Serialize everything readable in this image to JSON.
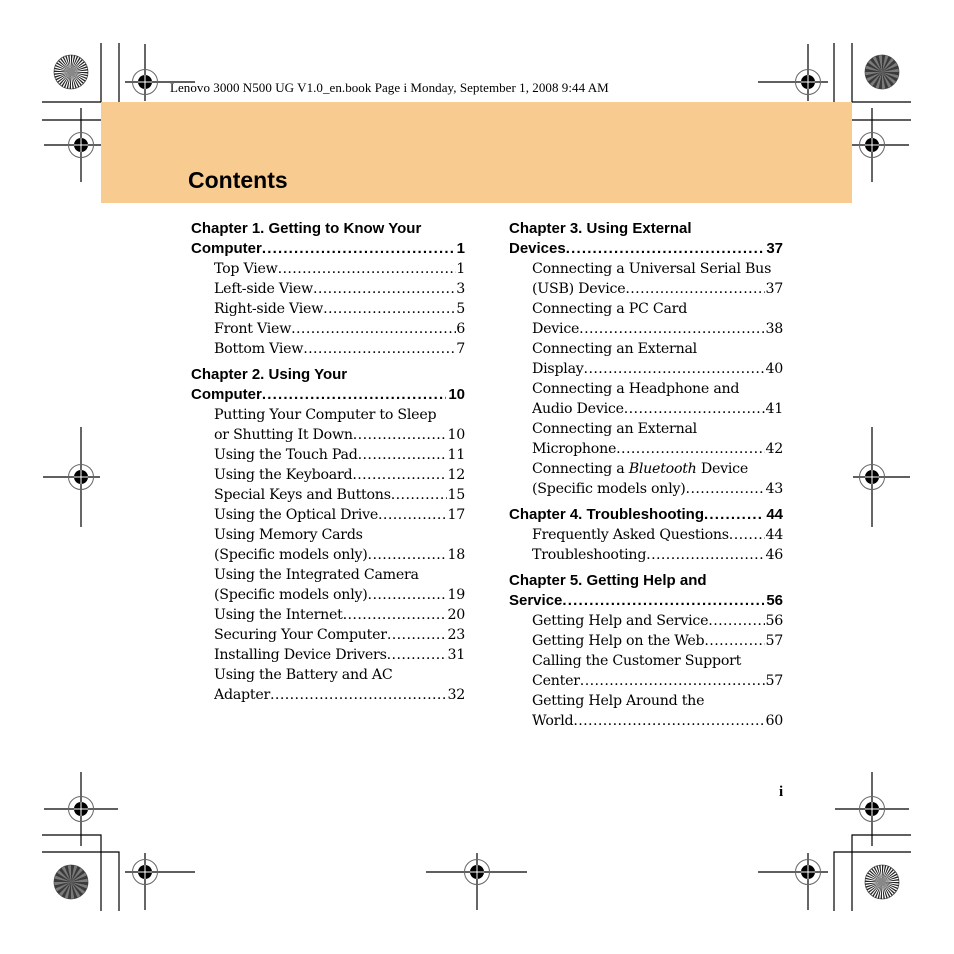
{
  "header": {
    "running_line": "Lenovo 3000 N500 UG V1.0_en.book  Page i  Monday, September 1, 2008  9:44 AM"
  },
  "band": {
    "title": "Contents",
    "color": "#f8cc90"
  },
  "left_column": [
    {
      "chapter_line1": "Chapter 1. Getting to Know Your",
      "chapter_line2": "Computer",
      "page": "1",
      "entries": [
        {
          "lines": [
            "Top View"
          ],
          "page": "1"
        },
        {
          "lines": [
            "Left-side View"
          ],
          "page": "3"
        },
        {
          "lines": [
            "Right-side View"
          ],
          "page": "5"
        },
        {
          "lines": [
            "Front View"
          ],
          "page": "6"
        },
        {
          "lines": [
            "Bottom View"
          ],
          "page": "7"
        }
      ]
    },
    {
      "chapter_line1": "Chapter 2. Using Your",
      "chapter_line2": "Computer",
      "page": "10",
      "entries": [
        {
          "lines": [
            "Putting Your Computer to Sleep",
            "or Shutting It Down"
          ],
          "page": "10"
        },
        {
          "lines": [
            "Using the Touch Pad"
          ],
          "page": "11"
        },
        {
          "lines": [
            "Using the Keyboard"
          ],
          "page": "12"
        },
        {
          "lines": [
            "Special Keys and Buttons"
          ],
          "page": "15"
        },
        {
          "lines": [
            "Using the Optical Drive"
          ],
          "page": "17"
        },
        {
          "lines": [
            "Using Memory Cards",
            "(Specific models only)"
          ],
          "page": "18"
        },
        {
          "lines": [
            "Using the Integrated Camera",
            "(Specific models only)"
          ],
          "page": "19"
        },
        {
          "lines": [
            "Using the Internet"
          ],
          "page": "20"
        },
        {
          "lines": [
            "Securing Your Computer"
          ],
          "page": "23"
        },
        {
          "lines": [
            "Installing Device Drivers"
          ],
          "page": "31"
        },
        {
          "lines": [
            "Using the Battery and AC",
            "Adapter"
          ],
          "page": "32"
        }
      ]
    }
  ],
  "right_column": [
    {
      "chapter_line1": "Chapter 3. Using External",
      "chapter_line2": "Devices",
      "page": "37",
      "entries": [
        {
          "lines": [
            "Connecting a Universal Serial Bus",
            "(USB) Device"
          ],
          "page": "37"
        },
        {
          "lines": [
            "Connecting a PC Card",
            "Device"
          ],
          "page": "38"
        },
        {
          "lines": [
            "Connecting an External",
            "Display"
          ],
          "page": "40"
        },
        {
          "lines": [
            "Connecting a Headphone and",
            "Audio Device"
          ],
          "page": "41"
        },
        {
          "lines": [
            "Connecting an External",
            "Microphone"
          ],
          "page": "42"
        },
        {
          "lines": [
            "Connecting a ",
            "(Specific models only)"
          ],
          "italic_word": "Bluetooth",
          "after_italic": " Device",
          "page": "43"
        }
      ]
    },
    {
      "chapter_line1": "Chapter 4. Troubleshooting",
      "chapter_line2": "",
      "page": "44",
      "entries": [
        {
          "lines": [
            "Frequently Asked Questions"
          ],
          "page": "44"
        },
        {
          "lines": [
            "Troubleshooting"
          ],
          "page": "46"
        }
      ]
    },
    {
      "chapter_line1": "Chapter 5. Getting Help and",
      "chapter_line2": "Service",
      "page": "56",
      "entries": [
        {
          "lines": [
            "Getting Help and Service"
          ],
          "page": "56"
        },
        {
          "lines": [
            "Getting Help on the Web"
          ],
          "page": "57"
        },
        {
          "lines": [
            "Calling the Customer Support",
            "Center"
          ],
          "page": "57"
        },
        {
          "lines": [
            "Getting Help Around the",
            "World"
          ],
          "page": "60"
        }
      ]
    }
  ],
  "footer": {
    "page_number": "i"
  }
}
